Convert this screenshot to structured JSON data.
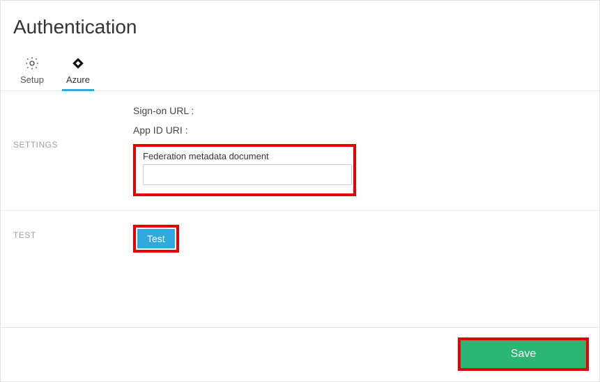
{
  "title": "Authentication",
  "tabs": {
    "setup": {
      "label": "Setup"
    },
    "azure": {
      "label": "Azure"
    }
  },
  "settings": {
    "section_label": "SETTINGS",
    "signon_label": "Sign-on URL :",
    "appid_label": "App ID URI :",
    "federation_label": "Federation metadata document",
    "federation_value": ""
  },
  "test": {
    "section_label": "TEST",
    "button_label": "Test"
  },
  "footer": {
    "save_label": "Save"
  }
}
